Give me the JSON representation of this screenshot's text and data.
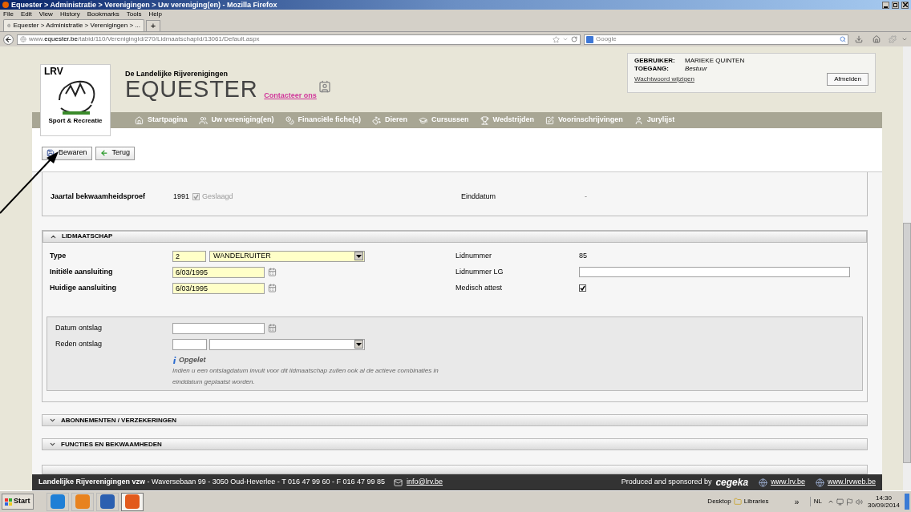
{
  "window": {
    "title": "Equester > Administratie > Verenigingen > Uw vereniging(en) - Mozilla Firefox"
  },
  "menu": [
    "File",
    "Edit",
    "View",
    "History",
    "Bookmarks",
    "Tools",
    "Help"
  ],
  "browser_tab": {
    "title": "Equester > Administratie > Verenigingen > ...",
    "new_tab": "+"
  },
  "address": {
    "prefix": "www.",
    "host": "equester.be",
    "path": "/tabid/110/VerenigingId/270/LidmaatschapId/13061/Default.aspx"
  },
  "search": {
    "placeholder": "Google"
  },
  "site": {
    "logo_text": "LRV",
    "logo_caption": "Sport & Recreatie",
    "subtitle": "De Landelijke Rijverenigingen",
    "title": "EQUESTER",
    "contact": "Contacteer ons"
  },
  "user": {
    "user_label": "GEBRUIKER:",
    "user": "MARIEKE QUINTEN",
    "access_label": "TOEGANG:",
    "access": "Bestuur",
    "password_link": "Wachtwoord wijzigen",
    "logout": "Afmelden"
  },
  "nav": [
    "Startpagina",
    "Uw vereniging(en)",
    "Financiële fiche(s)",
    "Dieren",
    "Cursussen",
    "Wedstrijden",
    "Voorinschrijvingen",
    "Jurylijst"
  ],
  "toolbar": [
    {
      "kind": "save",
      "label": "Bewaren"
    },
    {
      "kind": "back",
      "label": "Terug"
    }
  ],
  "proficiency": {
    "label": "Jaartal bekwaamheidsproef",
    "year": "1991",
    "passed_label": "Geslaagd",
    "passed_checked": true,
    "passed_disabled": true,
    "end_label": "Einddatum",
    "end_value": "-"
  },
  "membership": {
    "title": "LIDMAATSCHAP",
    "expanded": true,
    "type": {
      "label": "Type",
      "code": "2",
      "value": "WANDELRUITER"
    },
    "dates": [
      {
        "label": "Initiële aansluiting",
        "value": "6/03/1995"
      },
      {
        "label": "Huidige aansluiting",
        "value": "6/03/1995"
      }
    ],
    "member_number": {
      "label": "Lidnummer",
      "value": "85"
    },
    "member_number_lg": {
      "label": "Lidnummer LG"
    },
    "medical": {
      "label": "Medisch attest",
      "checked": true
    },
    "resignation": {
      "date_label": "Datum ontslag",
      "reason_label": "Reden ontslag",
      "note_title": "Opgelet",
      "note": "Indien u een ontslagdatum invult voor dit lidmaatschap zullen ook al de actieve combinaties in einddatum geplaatst worden."
    }
  },
  "sections": [
    {
      "title": "ABONNEMENTEN / VERZEKERINGEN",
      "expanded": false
    },
    {
      "title": "FUNCTIES EN BEKWAAMHEDEN",
      "expanded": false
    }
  ],
  "footer": {
    "org": "Landelijke Rijverenigingen vzw",
    "address": " - Waversebaan 99 - 3050 Oud-Heverlee - T 016 47 99 60 - F 016 47 99 85",
    "email": "info@lrv.be",
    "sponsor": "Produced and sponsored by",
    "sponsor_logo": "cegeka",
    "links": [
      "www.lrv.be",
      "www.lrvweb.be"
    ]
  },
  "taskbar": {
    "start": "Start",
    "apps": [
      {
        "selected": false
      },
      {
        "selected": false
      },
      {
        "selected": false
      },
      {
        "selected": true
      }
    ],
    "desktop": "Desktop",
    "libraries": "Libraries",
    "more": "»",
    "language": "NL",
    "time": "14:30",
    "date": "30/09/2014"
  }
}
